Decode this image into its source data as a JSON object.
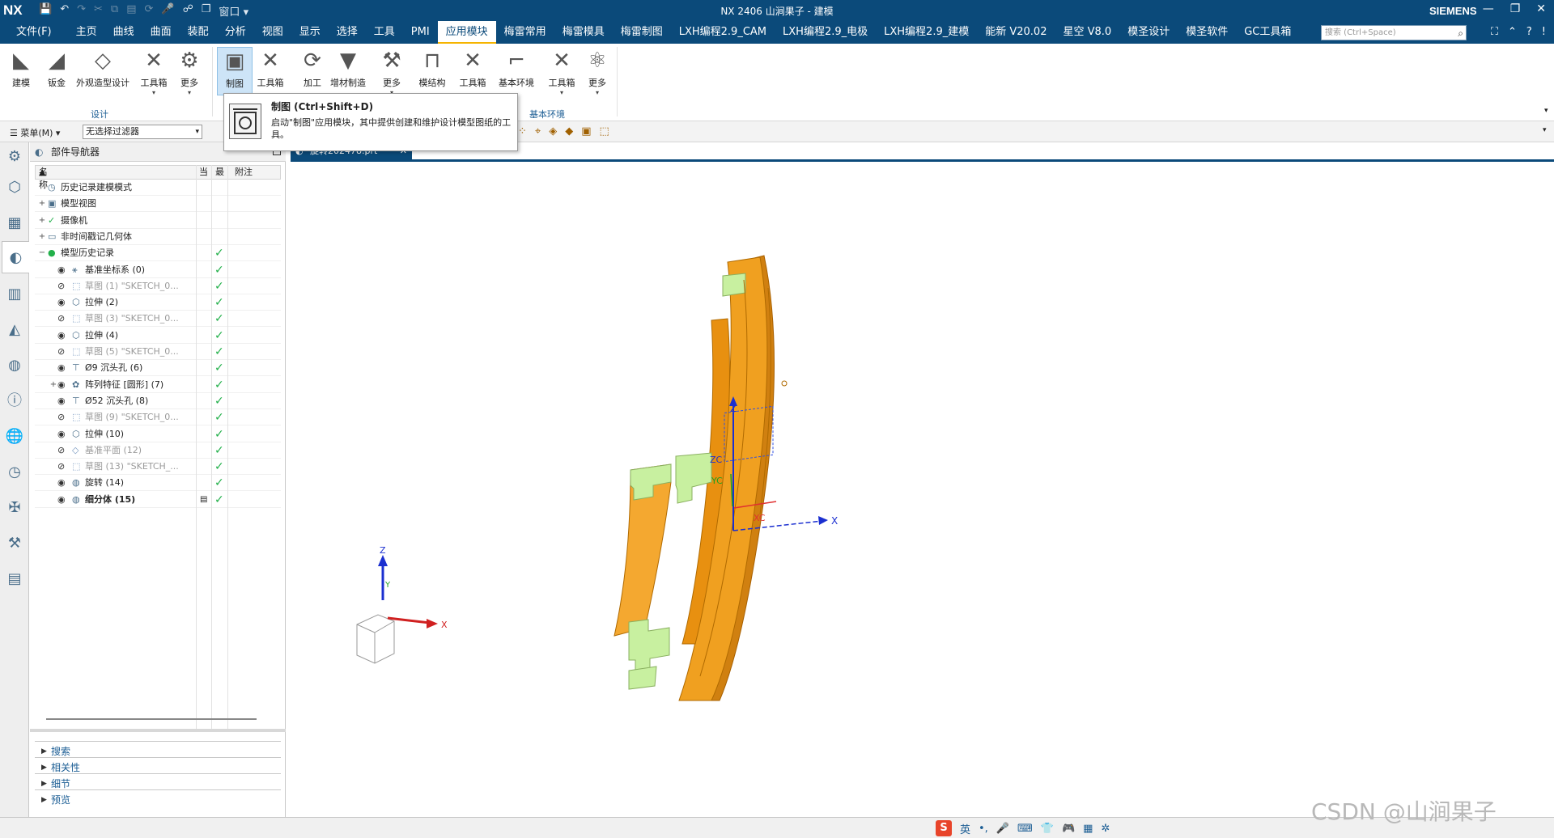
{
  "titlebar": {
    "logo": "NX",
    "title": "NX 2406 山涧果子 - 建模",
    "window_menu": "窗口",
    "brand": "SIEMENS"
  },
  "menubar": {
    "file": "文件(F)",
    "tabs": [
      "主页",
      "曲线",
      "曲面",
      "装配",
      "分析",
      "视图",
      "显示",
      "选择",
      "工具",
      "PMI",
      "应用模块",
      "梅雷常用",
      "梅雷模具",
      "梅雷制图",
      "LXH编程2.9_CAM",
      "LXH编程2.9_电极",
      "LXH编程2.9_建模",
      "能新 V20.02",
      "星空 V8.0",
      "模圣设计",
      "模圣软件",
      "GC工具箱"
    ],
    "active_tab": "应用模块",
    "search_placeholder": "搜索 (Ctrl+Space)"
  },
  "ribbon": {
    "buttons": [
      "建模",
      "钣金",
      "外观造型设计",
      "工具箱",
      "更多",
      "制图",
      "工具箱",
      "加工",
      "增材制造",
      "更多",
      "模结构",
      "工具箱",
      "基本环境",
      "工具箱",
      "更多"
    ],
    "groups": [
      "设计",
      "基本环境"
    ]
  },
  "tooltip": {
    "title": "制图 (Ctrl+Shift+D)",
    "description": "启动\"制图\"应用模块，其中提供创建和维护设计模型图纸的工具。"
  },
  "selection_bar": {
    "menu": "菜单(M)",
    "filter": "无选择过滤器"
  },
  "navigator": {
    "title": "部件导航器",
    "columns": [
      "名称",
      "当",
      "最",
      "附注"
    ],
    "rows": [
      {
        "label": "历史记录建模模式",
        "style": "normal"
      },
      {
        "label": "模型视图",
        "style": "normal"
      },
      {
        "label": "摄像机",
        "style": "normal"
      },
      {
        "label": "非时间戳记几何体",
        "style": "normal"
      },
      {
        "label": "模型历史记录",
        "style": "normal"
      },
      {
        "label": "基准坐标系 (0)",
        "style": "normal"
      },
      {
        "label": "草图 (1) \"SKETCH_0...",
        "style": "dim"
      },
      {
        "label": "拉伸 (2)",
        "style": "normal"
      },
      {
        "label": "草图 (3) \"SKETCH_0...",
        "style": "dim"
      },
      {
        "label": "拉伸 (4)",
        "style": "normal"
      },
      {
        "label": "草图 (5) \"SKETCH_0...",
        "style": "dim"
      },
      {
        "label": "Ø9 沉头孔 (6)",
        "style": "normal"
      },
      {
        "label": "阵列特征 [圆形] (7)",
        "style": "normal"
      },
      {
        "label": "Ø52 沉头孔 (8)",
        "style": "normal"
      },
      {
        "label": "草图 (9) \"SKETCH_0...",
        "style": "dim"
      },
      {
        "label": "拉伸 (10)",
        "style": "normal"
      },
      {
        "label": "基准平面 (12)",
        "style": "dim"
      },
      {
        "label": "草图 (13) \"SKETCH_...",
        "style": "dim"
      },
      {
        "label": "旋转 (14)",
        "style": "normal"
      },
      {
        "label": "细分体 (15)",
        "style": "bold"
      }
    ],
    "sections": [
      "搜索",
      "相关性",
      "细节",
      "预览"
    ]
  },
  "document_tab": "旋转202478.prt",
  "viewport": {
    "axis_labels": {
      "x": "X",
      "y": "Y",
      "z": "Z",
      "zc": "ZC",
      "yc": "YC",
      "xc": "XC"
    }
  },
  "statusbar": {
    "ime_lang": "英",
    "watermark": "CSDN @山涧果子"
  },
  "colors": {
    "titlebar": "#0b4a7a",
    "accent": "#f5b400",
    "model_body": "#f0a020",
    "model_face": "#c8f0a0",
    "check": "#22b04a"
  }
}
